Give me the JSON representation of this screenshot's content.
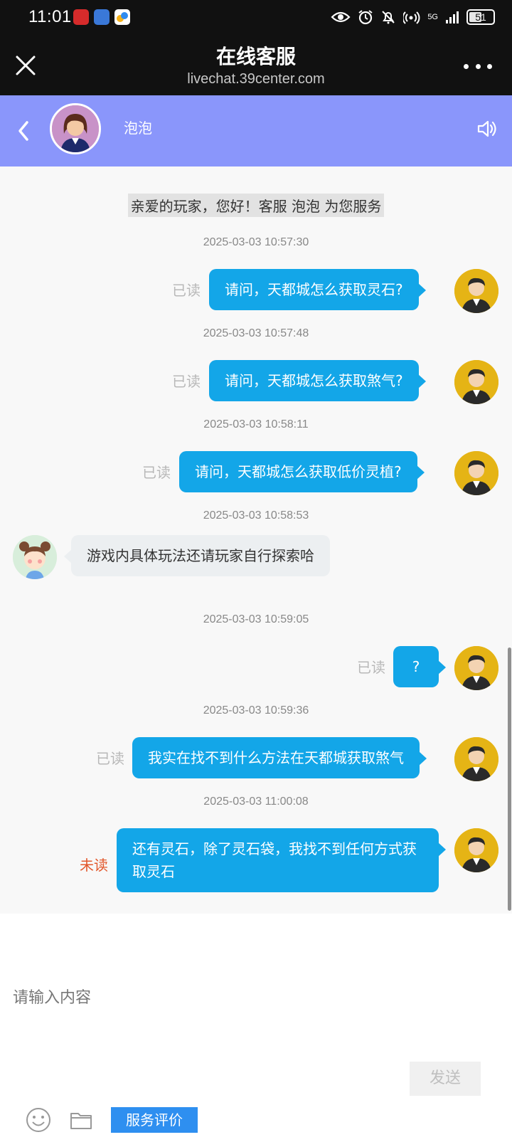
{
  "status_bar": {
    "time": "11:01",
    "signal_label": "5G",
    "battery": "51"
  },
  "browser": {
    "title": "在线客服",
    "url": "livechat.39center.com"
  },
  "agent": {
    "name": "泡泡"
  },
  "chat": {
    "welcome": "亲爱的玩家，您好！客服 泡泡 为您服务",
    "messages": [
      {
        "time": "2025-03-03 10:57:30",
        "from": "user",
        "text": "请问，天都城怎么获取灵石?",
        "status": "已读"
      },
      {
        "time": "2025-03-03 10:57:48",
        "from": "user",
        "text": "请问，天都城怎么获取煞气?",
        "status": "已读"
      },
      {
        "time": "2025-03-03 10:58:11",
        "from": "user",
        "text": "请问，天都城怎么获取低价灵植?",
        "status": "已读"
      },
      {
        "time": "2025-03-03 10:58:53",
        "from": "agent",
        "text": "游戏内具体玩法还请玩家自行探索哈",
        "status": ""
      },
      {
        "time": "2025-03-03 10:59:05",
        "from": "user",
        "text": "?",
        "status": "已读"
      },
      {
        "time": "2025-03-03 10:59:36",
        "from": "user",
        "text": "我实在找不到什么方法在天都城获取煞气",
        "status": "已读"
      },
      {
        "time": "2025-03-03 11:00:08",
        "from": "user",
        "text": "还有灵石，除了灵石袋，我找不到任何方式获取灵石",
        "status": "未读"
      }
    ]
  },
  "input": {
    "placeholder": "请输入内容",
    "rate_label": "服务评价",
    "send_label": "发送"
  },
  "colors": {
    "header_accent": "#8a96fb",
    "user_bubble": "#13a6e8",
    "unread": "#e2572b",
    "rate_button": "#2e8ff0"
  },
  "icons": [
    "close-icon",
    "more-icon",
    "back-icon",
    "speaker-icon",
    "emoji-icon",
    "folder-icon"
  ]
}
